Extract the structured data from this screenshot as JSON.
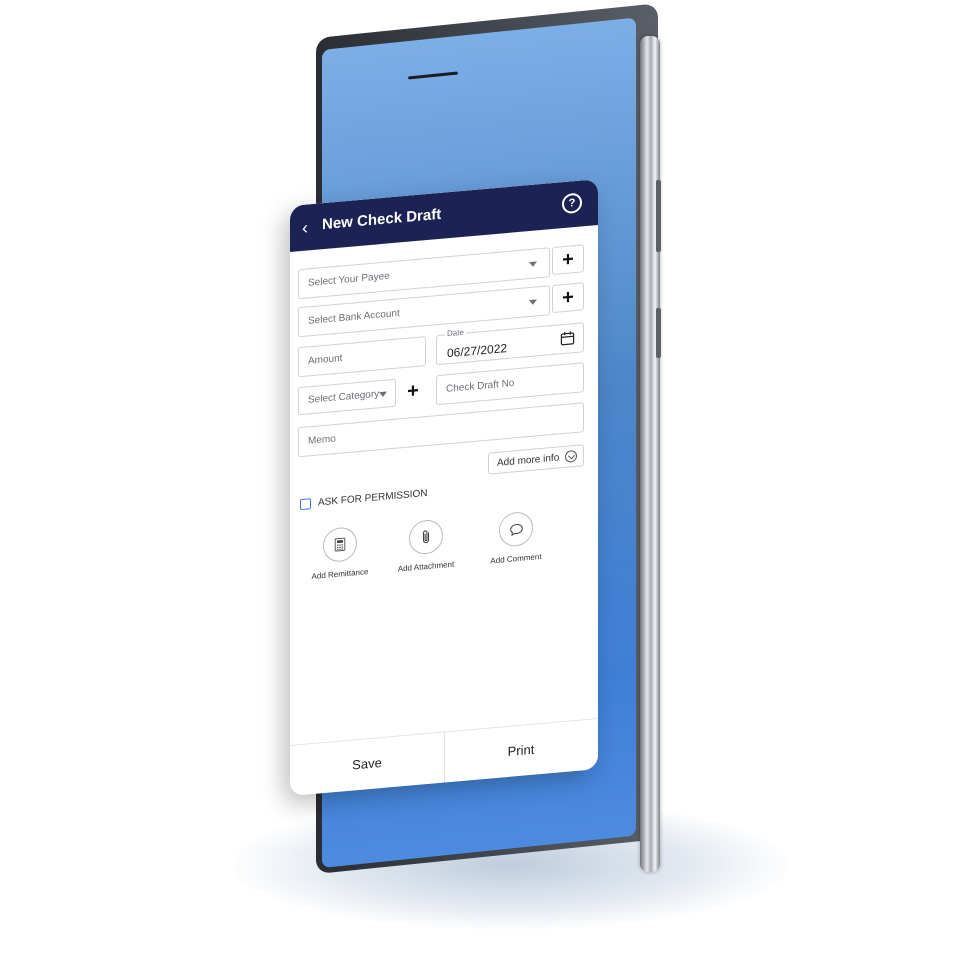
{
  "app": {
    "title": "New Check Draft",
    "help_icon": "help-circle-icon",
    "back_icon": "chevron-left-icon",
    "header_color": "#1c2354"
  },
  "form": {
    "payee_placeholder": "Select Your Payee",
    "bank_account_placeholder": "Select Bank Account",
    "amount_placeholder": "Amount",
    "date_label": "Date",
    "date_value": "06/27/2022",
    "category_placeholder": "Select Category",
    "check_draft_no_placeholder": "Check Draft No",
    "memo_placeholder": "Memo",
    "add_more_info_label": "Add more info",
    "add_symbol": "+"
  },
  "permission": {
    "label": "ASK FOR PERMISSION",
    "checked": false
  },
  "actions": [
    {
      "label": "Add Remittance",
      "icon": "calculator-icon"
    },
    {
      "label": "Add Attachment",
      "icon": "paperclip-icon"
    },
    {
      "label": "Add Comment",
      "icon": "comment-icon"
    }
  ],
  "footer": {
    "save_label": "Save",
    "print_label": "Print"
  },
  "phone": {
    "screen_color": "#4d86c9"
  }
}
